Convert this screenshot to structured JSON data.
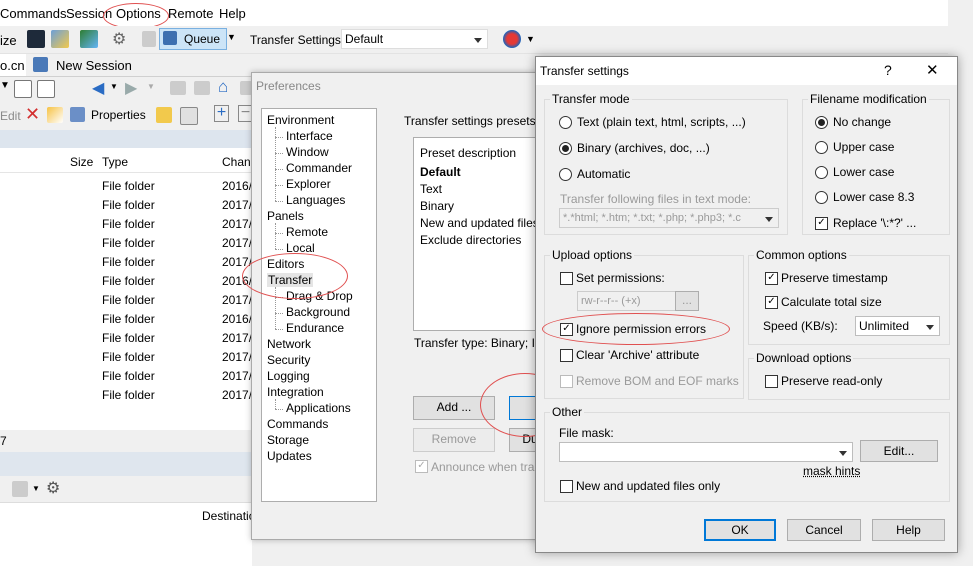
{
  "menu": [
    "Commands",
    "Session",
    "Options",
    "Remote",
    "Help"
  ],
  "toolbar1": {
    "size_fragment": "ize",
    "queue_label": "Queue",
    "transfer_settings_label": "Transfer Settings",
    "transfer_settings_value": "Default"
  },
  "tabs": {
    "host_fragment": "o.cn",
    "new_session": "New Session"
  },
  "toolbar3": {
    "edit_label": "Edit",
    "properties_label": "Properties"
  },
  "file_list": {
    "columns": {
      "size": "Size",
      "type": "Type",
      "changed": "Chang"
    },
    "rows": [
      {
        "type": "File folder",
        "changed": "2016/"
      },
      {
        "type": "File folder",
        "changed": "2017/"
      },
      {
        "type": "File folder",
        "changed": "2017/"
      },
      {
        "type": "File folder",
        "changed": "2017/"
      },
      {
        "type": "File folder",
        "changed": "2017/"
      },
      {
        "type": "File folder",
        "changed": "2016/"
      },
      {
        "type": "File folder",
        "changed": "2017/"
      },
      {
        "type": "File folder",
        "changed": "2016/"
      },
      {
        "type": "File folder",
        "changed": "2017/"
      },
      {
        "type": "File folder",
        "changed": "2017/"
      },
      {
        "type": "File folder",
        "changed": "2017/"
      },
      {
        "type": "File folder",
        "changed": "2017/"
      }
    ],
    "status_fragment": "7"
  },
  "lower_panel": {
    "destination_label": "Destinatio"
  },
  "preferences": {
    "title": "Preferences",
    "tree": [
      {
        "label": "Environment",
        "level": 0
      },
      {
        "label": "Interface",
        "level": 1
      },
      {
        "label": "Window",
        "level": 1
      },
      {
        "label": "Commander",
        "level": 1
      },
      {
        "label": "Explorer",
        "level": 1
      },
      {
        "label": "Languages",
        "level": 1
      },
      {
        "label": "Panels",
        "level": 0
      },
      {
        "label": "Remote",
        "level": 1
      },
      {
        "label": "Local",
        "level": 1
      },
      {
        "label": "Editors",
        "level": 0
      },
      {
        "label": "Transfer",
        "level": 0
      },
      {
        "label": "Drag & Drop",
        "level": 1
      },
      {
        "label": "Background",
        "level": 1
      },
      {
        "label": "Endurance",
        "level": 1
      },
      {
        "label": "Network",
        "level": 0
      },
      {
        "label": "Security",
        "level": 0
      },
      {
        "label": "Logging",
        "level": 0
      },
      {
        "label": "Integration",
        "level": 0
      },
      {
        "label": "Applications",
        "level": 1
      },
      {
        "label": "Commands",
        "level": 0
      },
      {
        "label": "Storage",
        "level": 0
      },
      {
        "label": "Updates",
        "level": 0
      }
    ],
    "presets_group": "Transfer settings presets",
    "preset_header": "Preset description",
    "presets": [
      "Default",
      "Text",
      "Binary",
      "New and updated files o",
      "Exclude directories"
    ],
    "transfer_type": "Transfer type: Binary; Ig",
    "add_button": "Add ...",
    "remove_button": "Remove",
    "dup_button": "Du",
    "announce_label": "Announce when trans"
  },
  "transfer_settings": {
    "title": "Transfer settings",
    "help_glyph": "?",
    "close_glyph": "✕",
    "transfer_mode": {
      "title": "Transfer mode",
      "text_option": "Text (plain text, html, scripts, ...)",
      "binary_option": "Binary (archives, doc, ...)",
      "automatic_option": "Automatic",
      "text_mode_label": "Transfer following files in text mode:",
      "text_mode_value": "*.*html; *.htm; *.txt; *.php; *.php3; *.c"
    },
    "filename_mod": {
      "title": "Filename modification",
      "no_change": "No change",
      "upper": "Upper case",
      "lower": "Lower case",
      "lower83": "Lower case 8.3",
      "replace": "Replace '\\:*?' ..."
    },
    "upload": {
      "title": "Upload options",
      "set_permissions": "Set permissions:",
      "permissions_value": "rw-r--r-- (+x)",
      "perm_button": "...",
      "ignore_errors": "Ignore permission errors",
      "clear_archive": "Clear 'Archive' attribute",
      "remove_bom": "Remove BOM and EOF marks"
    },
    "common": {
      "title": "Common options",
      "preserve_timestamp": "Preserve timestamp",
      "calc_size": "Calculate total size",
      "speed_label": "Speed (KB/s):",
      "speed_value": "Unlimited"
    },
    "download": {
      "title": "Download options",
      "preserve_readonly": "Preserve read-only"
    },
    "other": {
      "title": "Other",
      "file_mask_label": "File mask:",
      "file_mask_value": "",
      "edit_button": "Edit...",
      "mask_hints": "mask hints",
      "new_updated": "New and updated files only"
    },
    "ok_button": "OK",
    "cancel_button": "Cancel",
    "help_button": "Help"
  }
}
